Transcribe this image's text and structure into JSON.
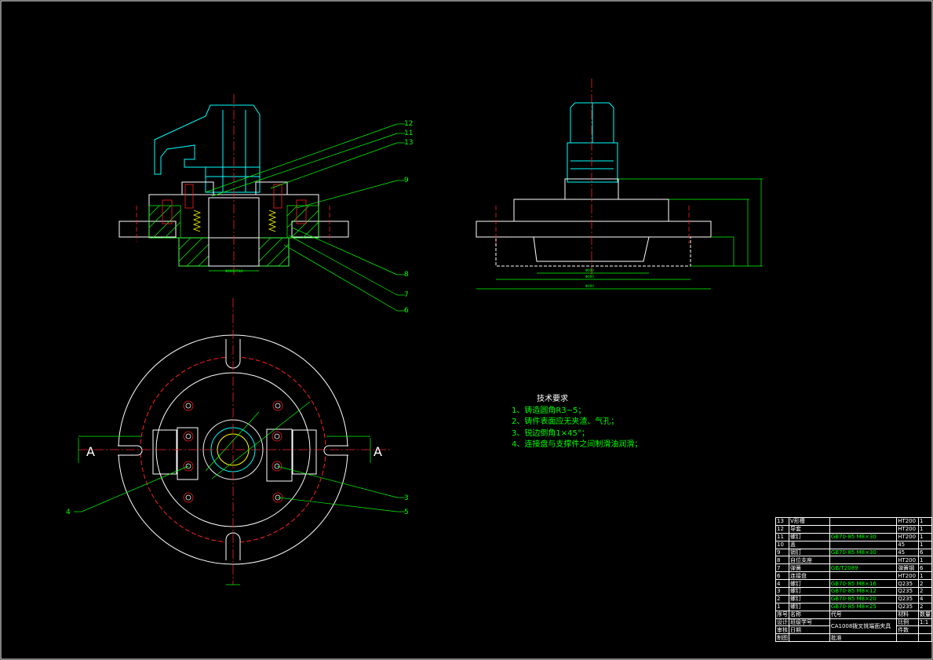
{
  "tech_requirements": {
    "title": "技术要求",
    "lines": [
      "1、铸造圆角R3~5；",
      "2、铸件表面应无夹渣、气孔；",
      "3、锐边倒角1×45°；",
      "4、连接盘与支撑件之间制滑油润滑；"
    ]
  },
  "section_labels": {
    "left": "A",
    "right": "A"
  },
  "balloons": {
    "front_view": [
      "12",
      "11",
      "13",
      "9",
      "8",
      "7",
      "6"
    ],
    "plan_view": [
      "4",
      "3",
      "5"
    ]
  },
  "parts_list": [
    {
      "no": "13",
      "name": "V形槽",
      "std": "",
      "mat": "HT200",
      "qty": "1"
    },
    {
      "no": "12",
      "name": "导套",
      "std": "",
      "mat": "HT200",
      "qty": "1"
    },
    {
      "no": "11",
      "name": "螺钉",
      "std": "GB70-85  M8×30",
      "mat": "HT200",
      "qty": "1"
    },
    {
      "no": "10",
      "name": "盖",
      "std": "",
      "mat": "45",
      "qty": "1"
    },
    {
      "no": "9",
      "name": "销钉",
      "std": "GB70-85  M8×30",
      "mat": "45",
      "qty": "6"
    },
    {
      "no": "8",
      "name": "自位支座",
      "std": "",
      "mat": "HT200",
      "qty": "1"
    },
    {
      "no": "7",
      "name": "弹簧",
      "std": "GB/T2089",
      "mat": "弹簧钢",
      "qty": "6"
    },
    {
      "no": "6",
      "name": "连接盘",
      "std": "",
      "mat": "HT200",
      "qty": "1"
    },
    {
      "no": "4",
      "name": "螺钉",
      "std": "GB70-85  M8×16",
      "mat": "Q235",
      "qty": "2"
    },
    {
      "no": "3",
      "name": "螺钉",
      "std": "GB70-85  M8×12",
      "mat": "Q235",
      "qty": "2"
    },
    {
      "no": "2",
      "name": "螺钉",
      "std": "GB70-85  M8×20",
      "mat": "Q235",
      "qty": "4"
    },
    {
      "no": "1",
      "name": "螺钉",
      "std": "GB70-85  M8×25",
      "mat": "Q235",
      "qty": "2"
    }
  ],
  "parts_header": {
    "no": "序号",
    "name": "名称",
    "std": "代号",
    "mat": "材料",
    "qty": "数量"
  },
  "title_block": {
    "drawing_title": "CA1008拨叉铣端面夹具",
    "scale_label": "比例",
    "scale": "1:1",
    "qty_label": "件数",
    "designer_label": "设计",
    "checker_label": "审核",
    "drafter_label": "制图",
    "approver_label": "批准",
    "school_label": "班级学号",
    "date_label": "日期"
  }
}
